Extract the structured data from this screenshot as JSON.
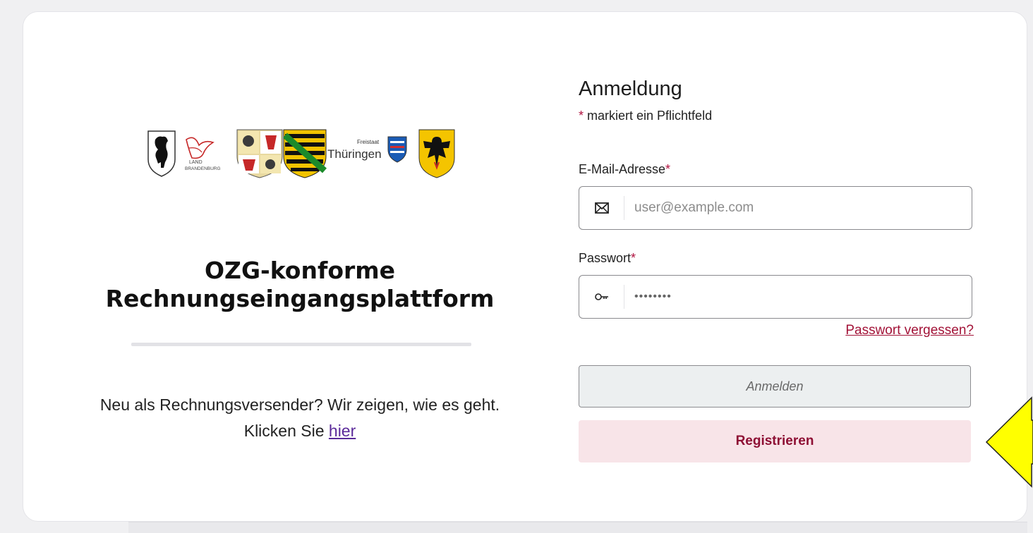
{
  "left": {
    "logo_text_brandenburg": "LAND BRANDENBURG",
    "logo_text_thueringen_small": "Freistaat",
    "logo_text_thueringen": "Thüringen",
    "headline": "OZG-konforme Rechnungseingangsplattform",
    "intro_text": "Neu als Rechnungsversender? Wir zeigen, wie es geht. Klicken Sie ",
    "intro_link": "hier"
  },
  "form": {
    "title": "Anmeldung",
    "required_star": "*",
    "required_note": " markiert ein Pflichtfeld",
    "email_label": "E-Mail-Adresse",
    "email_placeholder": "user@example.com",
    "password_label": "Passwort",
    "password_value": "••••••••",
    "forgot_link": "Passwort vergessen?",
    "login_button": "Anmelden",
    "register_button": "Registrieren"
  },
  "icons": {
    "email": "envelope-icon",
    "password": "key-icon",
    "annotation": "yellow-arrow-pointer"
  },
  "colors": {
    "accent": "#a21237",
    "register_bg": "#f8e4e8",
    "arrow": "#ffff00"
  }
}
